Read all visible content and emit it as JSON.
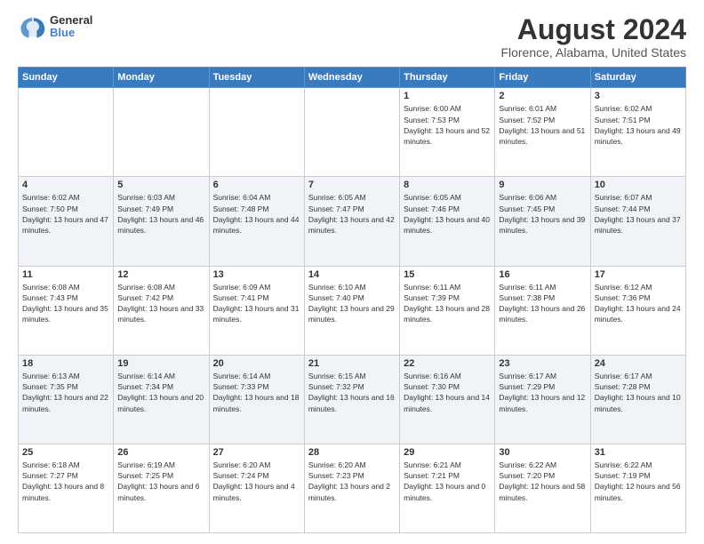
{
  "logo": {
    "general": "General",
    "blue": "Blue"
  },
  "header": {
    "title": "August 2024",
    "subtitle": "Florence, Alabama, United States"
  },
  "weekdays": [
    "Sunday",
    "Monday",
    "Tuesday",
    "Wednesday",
    "Thursday",
    "Friday",
    "Saturday"
  ],
  "weeks": [
    [
      {
        "day": "",
        "info": ""
      },
      {
        "day": "",
        "info": ""
      },
      {
        "day": "",
        "info": ""
      },
      {
        "day": "",
        "info": ""
      },
      {
        "day": "1",
        "sunrise": "6:00 AM",
        "sunset": "7:53 PM",
        "daylight": "13 hours and 52 minutes."
      },
      {
        "day": "2",
        "sunrise": "6:01 AM",
        "sunset": "7:52 PM",
        "daylight": "13 hours and 51 minutes."
      },
      {
        "day": "3",
        "sunrise": "6:02 AM",
        "sunset": "7:51 PM",
        "daylight": "13 hours and 49 minutes."
      }
    ],
    [
      {
        "day": "4",
        "sunrise": "6:02 AM",
        "sunset": "7:50 PM",
        "daylight": "13 hours and 47 minutes."
      },
      {
        "day": "5",
        "sunrise": "6:03 AM",
        "sunset": "7:49 PM",
        "daylight": "13 hours and 46 minutes."
      },
      {
        "day": "6",
        "sunrise": "6:04 AM",
        "sunset": "7:48 PM",
        "daylight": "13 hours and 44 minutes."
      },
      {
        "day": "7",
        "sunrise": "6:05 AM",
        "sunset": "7:47 PM",
        "daylight": "13 hours and 42 minutes."
      },
      {
        "day": "8",
        "sunrise": "6:05 AM",
        "sunset": "7:46 PM",
        "daylight": "13 hours and 40 minutes."
      },
      {
        "day": "9",
        "sunrise": "6:06 AM",
        "sunset": "7:45 PM",
        "daylight": "13 hours and 39 minutes."
      },
      {
        "day": "10",
        "sunrise": "6:07 AM",
        "sunset": "7:44 PM",
        "daylight": "13 hours and 37 minutes."
      }
    ],
    [
      {
        "day": "11",
        "sunrise": "6:08 AM",
        "sunset": "7:43 PM",
        "daylight": "13 hours and 35 minutes."
      },
      {
        "day": "12",
        "sunrise": "6:08 AM",
        "sunset": "7:42 PM",
        "daylight": "13 hours and 33 minutes."
      },
      {
        "day": "13",
        "sunrise": "6:09 AM",
        "sunset": "7:41 PM",
        "daylight": "13 hours and 31 minutes."
      },
      {
        "day": "14",
        "sunrise": "6:10 AM",
        "sunset": "7:40 PM",
        "daylight": "13 hours and 29 minutes."
      },
      {
        "day": "15",
        "sunrise": "6:11 AM",
        "sunset": "7:39 PM",
        "daylight": "13 hours and 28 minutes."
      },
      {
        "day": "16",
        "sunrise": "6:11 AM",
        "sunset": "7:38 PM",
        "daylight": "13 hours and 26 minutes."
      },
      {
        "day": "17",
        "sunrise": "6:12 AM",
        "sunset": "7:36 PM",
        "daylight": "13 hours and 24 minutes."
      }
    ],
    [
      {
        "day": "18",
        "sunrise": "6:13 AM",
        "sunset": "7:35 PM",
        "daylight": "13 hours and 22 minutes."
      },
      {
        "day": "19",
        "sunrise": "6:14 AM",
        "sunset": "7:34 PM",
        "daylight": "13 hours and 20 minutes."
      },
      {
        "day": "20",
        "sunrise": "6:14 AM",
        "sunset": "7:33 PM",
        "daylight": "13 hours and 18 minutes."
      },
      {
        "day": "21",
        "sunrise": "6:15 AM",
        "sunset": "7:32 PM",
        "daylight": "13 hours and 16 minutes."
      },
      {
        "day": "22",
        "sunrise": "6:16 AM",
        "sunset": "7:30 PM",
        "daylight": "13 hours and 14 minutes."
      },
      {
        "day": "23",
        "sunrise": "6:17 AM",
        "sunset": "7:29 PM",
        "daylight": "13 hours and 12 minutes."
      },
      {
        "day": "24",
        "sunrise": "6:17 AM",
        "sunset": "7:28 PM",
        "daylight": "13 hours and 10 minutes."
      }
    ],
    [
      {
        "day": "25",
        "sunrise": "6:18 AM",
        "sunset": "7:27 PM",
        "daylight": "13 hours and 8 minutes."
      },
      {
        "day": "26",
        "sunrise": "6:19 AM",
        "sunset": "7:25 PM",
        "daylight": "13 hours and 6 minutes."
      },
      {
        "day": "27",
        "sunrise": "6:20 AM",
        "sunset": "7:24 PM",
        "daylight": "13 hours and 4 minutes."
      },
      {
        "day": "28",
        "sunrise": "6:20 AM",
        "sunset": "7:23 PM",
        "daylight": "13 hours and 2 minutes."
      },
      {
        "day": "29",
        "sunrise": "6:21 AM",
        "sunset": "7:21 PM",
        "daylight": "13 hours and 0 minutes."
      },
      {
        "day": "30",
        "sunrise": "6:22 AM",
        "sunset": "7:20 PM",
        "daylight": "12 hours and 58 minutes."
      },
      {
        "day": "31",
        "sunrise": "6:22 AM",
        "sunset": "7:19 PM",
        "daylight": "12 hours and 56 minutes."
      }
    ]
  ]
}
